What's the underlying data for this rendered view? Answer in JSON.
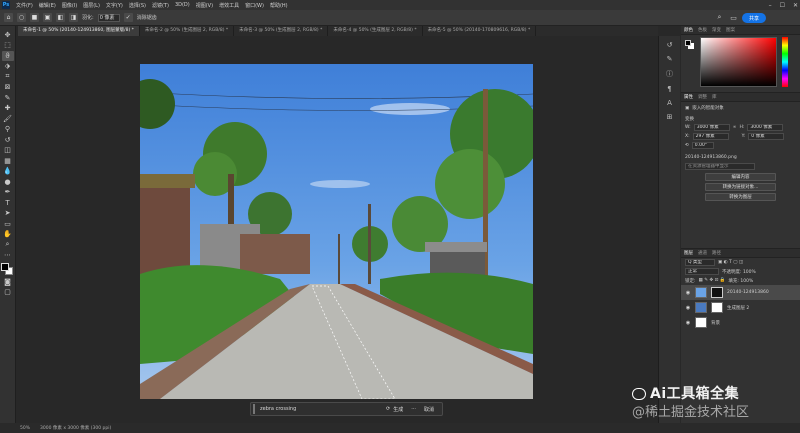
{
  "menubar": {
    "logo": "Ps",
    "items": [
      "文件(F)",
      "编辑(E)",
      "图像(I)",
      "图层(L)",
      "文字(Y)",
      "选择(S)",
      "滤镜(T)",
      "3D(D)",
      "视图(V)",
      "增效工具",
      "窗口(W)",
      "帮助(H)"
    ]
  },
  "optbar": {
    "feather_label": "羽化:",
    "feather_value": "0 像素",
    "antialias_label": "消除锯齿",
    "share_label": "共享"
  },
  "tabs": [
    {
      "label": "未命名-1 @ 50% (20140-124913860, 图层蒙版/8) *",
      "active": true
    },
    {
      "label": "未命名-2 @ 50% (生成图层 2, RGB/8) *",
      "active": false
    },
    {
      "label": "未命名-3 @ 50% (生成图层 2, RGB/8) *",
      "active": false
    },
    {
      "label": "未命名-4 @ 50% (生成图层 2, RGB/8) *",
      "active": false
    },
    {
      "label": "未命名-5 @ 50% (20140-170809616, RGB/8) *",
      "active": false
    }
  ],
  "generative_bar": {
    "prompt_value": "zebra crossing",
    "generate_label": "生成",
    "more_label": "···",
    "cancel_label": "取消"
  },
  "status": {
    "zoom": "50%",
    "doc_size": "3000 像素 x 3000 像素 (300 ppi)"
  },
  "color_panel": {
    "tabs": [
      "颜色",
      "色板",
      "渐变",
      "图案"
    ]
  },
  "properties_panel": {
    "tabs": [
      "属性",
      "调整",
      "库"
    ],
    "object_type": "嵌入的智能对象",
    "transform_label": "变换",
    "w_label": "W:",
    "w_value": "3000 像素",
    "h_label": "H:",
    "h_value": "3000 像素",
    "x_label": "X:",
    "x_value": "297 像素",
    "y_label": "Y:",
    "y_value": "0 像素",
    "angle_value": "0.00°",
    "filename": "20140-124913860.png",
    "locate_label": "在资源管理器中显示",
    "buttons": [
      "编辑内容",
      "转换为链接对象...",
      "转换为图层"
    ]
  },
  "layers_panel": {
    "tabs": [
      "图层",
      "通道",
      "路径"
    ],
    "kind_label": "Q 类型",
    "mode_label": "正常",
    "opacity_label": "不透明度: 100%",
    "lock_label": "锁定:",
    "fill_label": "填充: 100%",
    "layers": [
      {
        "name": "20140-124913860",
        "selected": true
      },
      {
        "name": "生成图层 2",
        "selected": false
      },
      {
        "name": "背景",
        "selected": false
      }
    ]
  },
  "watermark": {
    "line1": "Ai工具箱全集",
    "line2": "@稀土掘金技术社区"
  }
}
